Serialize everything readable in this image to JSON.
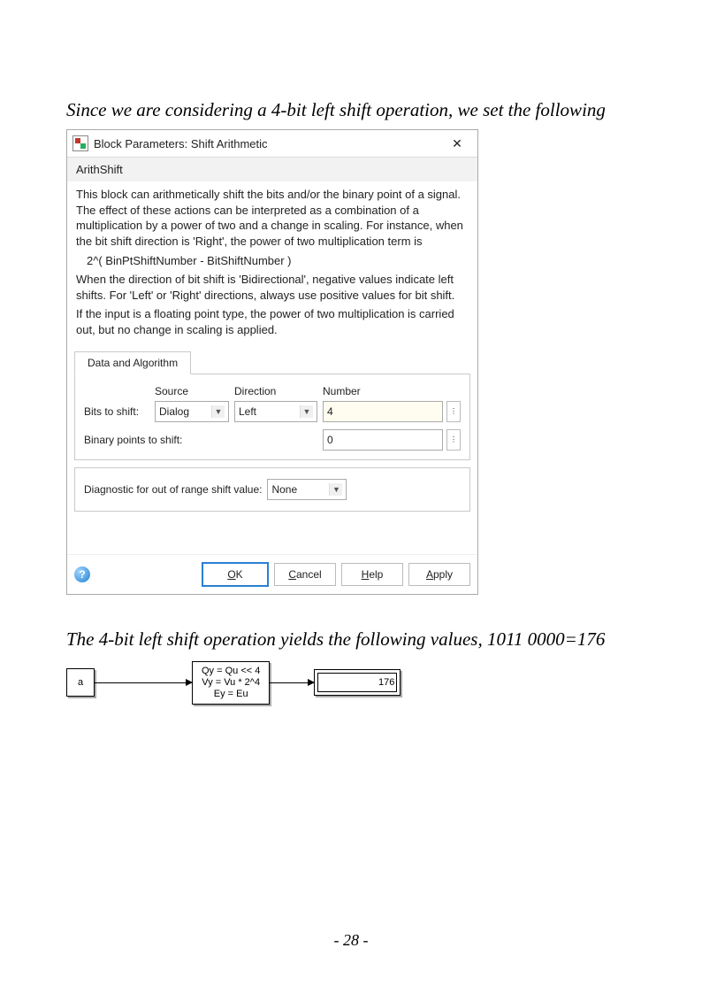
{
  "prose1": "Since we are considering a 4-bit left shift operation, we set the following",
  "prose2": "The 4-bit left shift operation yields the following values, 1011 0000=176",
  "pagenum": "- 28 -",
  "dialog": {
    "title": "Block Parameters: Shift Arithmetic",
    "section": "ArithShift",
    "desc_p1": "This block can arithmetically shift the bits and/or the binary point of a signal.",
    "desc_p2": "The effect of these actions can be interpreted as a combination of a multiplication by a power of two and a change in scaling.  For instance, when the bit shift direction is 'Right', the power of two multiplication term is",
    "desc_eq": "2^( BinPtShiftNumber - BitShiftNumber )",
    "desc_p3": "When the direction of bit shift is 'Bidirectional', negative values indicate left shifts. For 'Left' or 'Right' directions, always use positive values for bit shift.",
    "desc_p4": "If the input is a floating point type, the power of two multiplication is carried out, but no change in scaling is applied.",
    "tab": "Data and Algorithm",
    "hdr_source": "Source",
    "hdr_direction": "Direction",
    "hdr_number": "Number",
    "lbl_bits": "Bits to shift:",
    "sel_source": "Dialog",
    "sel_direction": "Left",
    "val_number": "4",
    "lbl_binpts": "Binary points to shift:",
    "val_binpts": "0",
    "lbl_diag": "Diagnostic for out of range shift value:",
    "sel_diag": "None",
    "btn_ok_u": "O",
    "btn_ok_r": "K",
    "btn_cancel_u": "C",
    "btn_cancel_r": "ancel",
    "btn_help_u": "H",
    "btn_help_r": "elp",
    "btn_apply_u": "A",
    "btn_apply_r": "pply"
  },
  "diagram": {
    "a": "a",
    "mid1": "Qy = Qu << 4",
    "mid2": "Vy = Vu * 2^4",
    "mid3": "Ey = Eu",
    "out": "176"
  }
}
